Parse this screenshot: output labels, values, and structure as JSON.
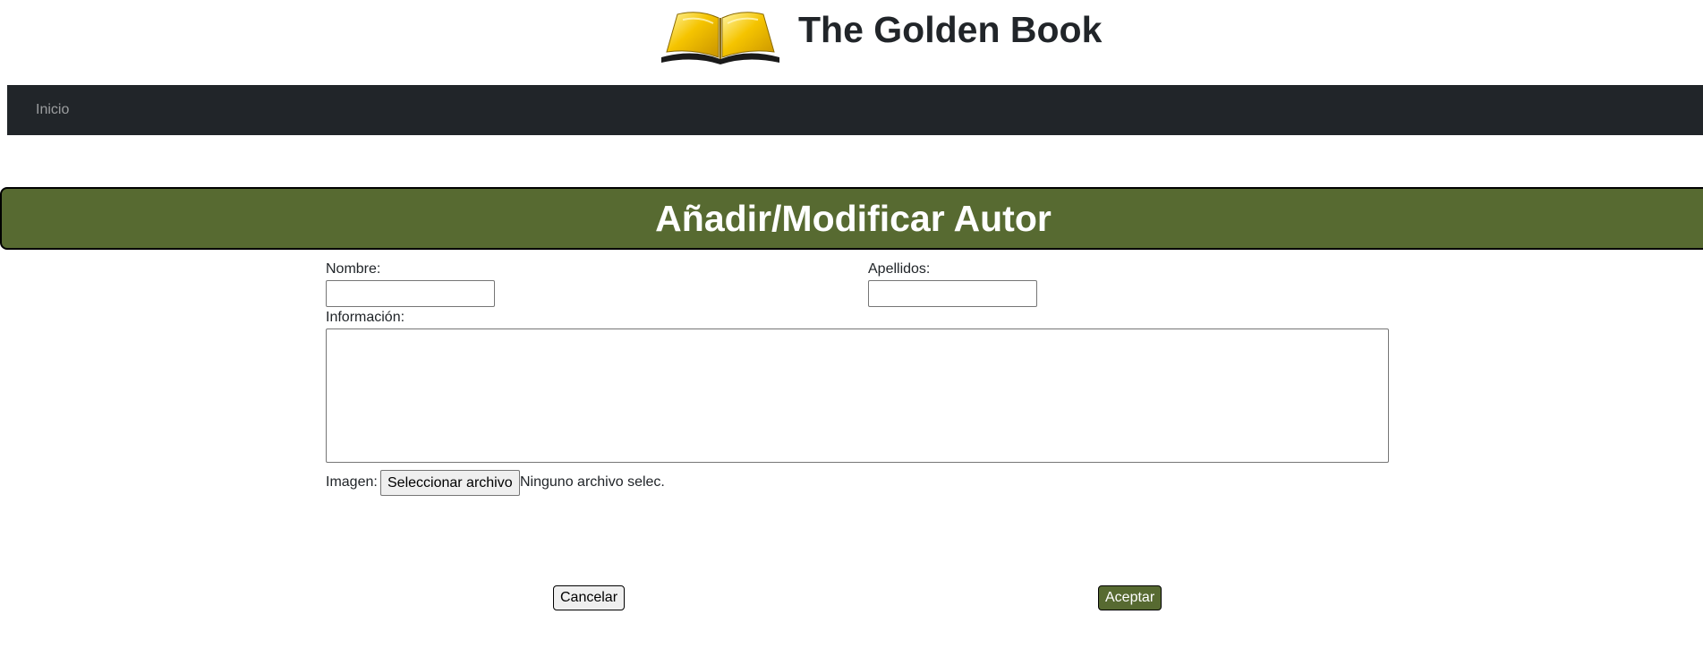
{
  "header": {
    "logo_icon": "open-golden-book-icon",
    "site_title": "The Golden Book"
  },
  "navbar": {
    "items": [
      {
        "label": "Inicio"
      }
    ]
  },
  "banner": {
    "title": "Añadir/Modificar Autor"
  },
  "form": {
    "nombre_label": "Nombre:",
    "nombre_value": "",
    "apellidos_label": "Apellidos:",
    "apellidos_value": "",
    "informacion_label": "Información:",
    "informacion_value": "",
    "imagen_label": "Imagen:",
    "file_button_label": "Seleccionar archivo",
    "file_status": "Ninguno archivo selec."
  },
  "actions": {
    "cancel_label": "Cancelar",
    "accept_label": "Aceptar"
  },
  "colors": {
    "navbar_bg": "#212529",
    "accent_green": "#576a31",
    "gold": "#f5c400"
  }
}
